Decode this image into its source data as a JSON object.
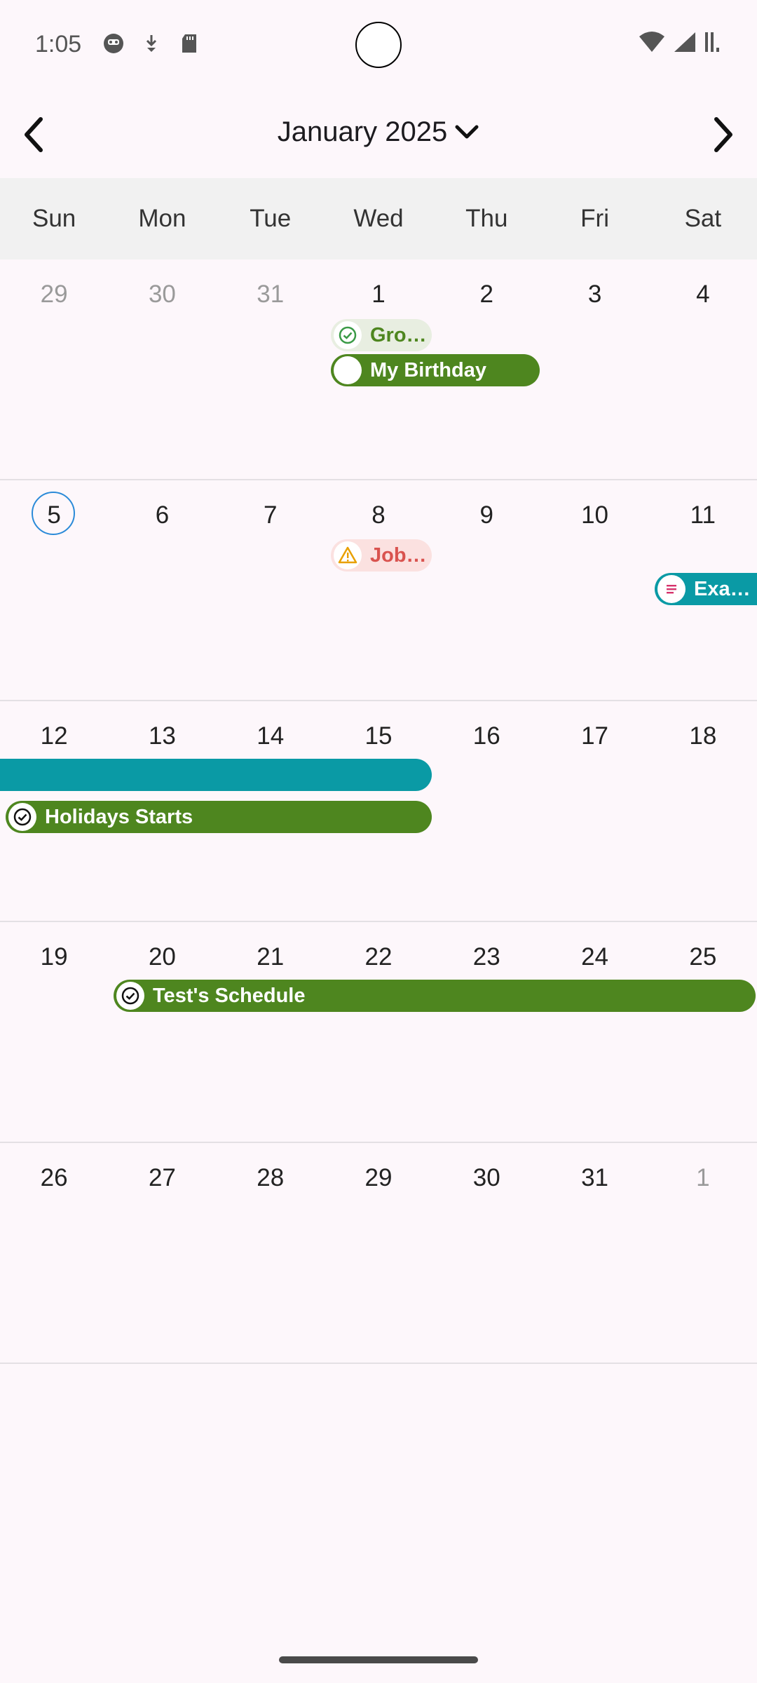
{
  "status_bar": {
    "time": "1:05",
    "left_icons": [
      "face-icon",
      "download-icon",
      "sd-card-icon"
    ],
    "right_icons": [
      "wifi-icon",
      "cellular-icon",
      "battery-icon"
    ]
  },
  "header": {
    "month_title": "January 2025",
    "prev_icon": "chevron-left-icon",
    "next_icon": "chevron-right-icon",
    "dropdown_icon": "chevron-down-icon"
  },
  "weekdays": [
    "Sun",
    "Mon",
    "Tue",
    "Wed",
    "Thu",
    "Fri",
    "Sat"
  ],
  "weeks": [
    {
      "days": [
        "29",
        "30",
        "31",
        "1",
        "2",
        "3",
        "4"
      ]
    },
    {
      "days": [
        "5",
        "6",
        "7",
        "8",
        "9",
        "10",
        "11"
      ]
    },
    {
      "days": [
        "12",
        "13",
        "14",
        "15",
        "16",
        "17",
        "18"
      ]
    },
    {
      "days": [
        "19",
        "20",
        "21",
        "22",
        "23",
        "24",
        "25"
      ]
    },
    {
      "days": [
        "26",
        "27",
        "28",
        "29",
        "30",
        "31",
        "1"
      ]
    }
  ],
  "today": "5",
  "events": {
    "groceries": {
      "label": "Gro…",
      "icon": "check-circle-icon",
      "color": "#4e861f"
    },
    "birthday": {
      "label": "My Birthday",
      "icon": "circle-icon",
      "color": "#4e861f"
    },
    "job": {
      "label": "Job…",
      "icon": "warning-icon",
      "color": "#d9534f"
    },
    "exam": {
      "label": "Exa…",
      "icon": "notes-icon",
      "color": "#0a9aa5"
    },
    "exam_continued": {
      "label": "",
      "color": "#0a9aa5"
    },
    "holidays": {
      "label": "Holidays Starts",
      "icon": "check-circle-icon",
      "color": "#4e861f"
    },
    "test": {
      "label": "Test's Schedule",
      "icon": "check-circle-icon",
      "color": "#4e861f"
    }
  },
  "colors": {
    "background": "#fdf7fb",
    "weekday_bar": "#f1f1f1",
    "today_ring": "#2a8ad8",
    "event_green": "#4e861f",
    "event_teal": "#0a9aa5"
  }
}
